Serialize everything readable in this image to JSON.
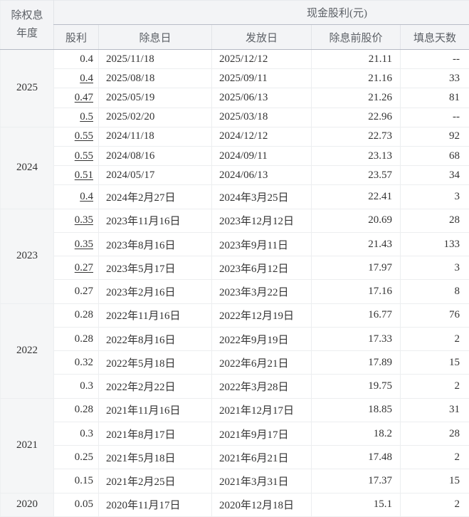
{
  "table": {
    "year_header_line1": "除权息",
    "year_header_line2": "年度",
    "cash_header": "现金股利(元)",
    "columns": [
      "股利",
      "除息日",
      "发放日",
      "除息前股价",
      "填息天数"
    ],
    "empty_days_placeholder": "--",
    "colors": {
      "header_bg": "#f3f4f6",
      "year_column_bg": "#f5f6f7",
      "row_border": "#eceef0",
      "header_border": "#b5bac4",
      "text_primary": "#333333",
      "text_header": "#5c6066"
    },
    "groups": [
      {
        "year": "2025",
        "rows": [
          {
            "dividend": "0.4",
            "ex_date": "2025/11/18",
            "pay_date": "2025/12/12",
            "price": "21.11",
            "days": "--",
            "linked": false
          },
          {
            "dividend": "0.4",
            "ex_date": "2025/08/18",
            "pay_date": "2025/09/11",
            "price": "21.16",
            "days": "33",
            "linked": true
          },
          {
            "dividend": "0.47",
            "ex_date": "2025/05/19",
            "pay_date": "2025/06/13",
            "price": "21.26",
            "days": "81",
            "linked": true
          },
          {
            "dividend": "0.5",
            "ex_date": "2025/02/20",
            "pay_date": "2025/03/18",
            "price": "22.96",
            "days": "--",
            "linked": true
          }
        ]
      },
      {
        "year": "2024",
        "rows": [
          {
            "dividend": "0.55",
            "ex_date": "2024/11/18",
            "pay_date": "2024/12/12",
            "price": "22.73",
            "days": "92",
            "linked": true
          },
          {
            "dividend": "0.55",
            "ex_date": "2024/08/16",
            "pay_date": "2024/09/11",
            "price": "23.13",
            "days": "68",
            "linked": true
          },
          {
            "dividend": "0.51",
            "ex_date": "2024/05/17",
            "pay_date": "2024/06/13",
            "price": "23.57",
            "days": "34",
            "linked": true
          },
          {
            "dividend": "0.4",
            "ex_date": "2024年2月27日",
            "pay_date": "2024年3月25日",
            "price": "22.41",
            "days": "3",
            "linked": true
          }
        ]
      },
      {
        "year": "2023",
        "rows": [
          {
            "dividend": "0.35",
            "ex_date": "2023年11月16日",
            "pay_date": "2023年12月12日",
            "price": "20.69",
            "days": "28",
            "linked": true
          },
          {
            "dividend": "0.35",
            "ex_date": "2023年8月16日",
            "pay_date": "2023年9月11日",
            "price": "21.43",
            "days": "133",
            "linked": true
          },
          {
            "dividend": "0.27",
            "ex_date": "2023年5月17日",
            "pay_date": "2023年6月12日",
            "price": "17.97",
            "days": "3",
            "linked": true
          },
          {
            "dividend": "0.27",
            "ex_date": "2023年2月16日",
            "pay_date": "2023年3月22日",
            "price": "17.16",
            "days": "8",
            "linked": false
          }
        ]
      },
      {
        "year": "2022",
        "rows": [
          {
            "dividend": "0.28",
            "ex_date": "2022年11月16日",
            "pay_date": "2022年12月19日",
            "price": "16.77",
            "days": "76",
            "linked": false
          },
          {
            "dividend": "0.28",
            "ex_date": "2022年8月16日",
            "pay_date": "2022年9月19日",
            "price": "17.33",
            "days": "2",
            "linked": false
          },
          {
            "dividend": "0.32",
            "ex_date": "2022年5月18日",
            "pay_date": "2022年6月21日",
            "price": "17.89",
            "days": "15",
            "linked": false
          },
          {
            "dividend": "0.3",
            "ex_date": "2022年2月22日",
            "pay_date": "2022年3月28日",
            "price": "19.75",
            "days": "2",
            "linked": false
          }
        ]
      },
      {
        "year": "2021",
        "rows": [
          {
            "dividend": "0.28",
            "ex_date": "2021年11月16日",
            "pay_date": "2021年12月17日",
            "price": "18.85",
            "days": "31",
            "linked": false
          },
          {
            "dividend": "0.3",
            "ex_date": "2021年8月17日",
            "pay_date": "2021年9月17日",
            "price": "18.2",
            "days": "28",
            "linked": false
          },
          {
            "dividend": "0.25",
            "ex_date": "2021年5月18日",
            "pay_date": "2021年6月21日",
            "price": "17.48",
            "days": "2",
            "linked": false
          },
          {
            "dividend": "0.15",
            "ex_date": "2021年2月25日",
            "pay_date": "2021年3月31日",
            "price": "17.37",
            "days": "15",
            "linked": false
          }
        ]
      },
      {
        "year": "2020",
        "rows": [
          {
            "dividend": "0.05",
            "ex_date": "2020年11月17日",
            "pay_date": "2020年12月18日",
            "price": "15.1",
            "days": "2",
            "linked": false
          }
        ]
      }
    ]
  }
}
